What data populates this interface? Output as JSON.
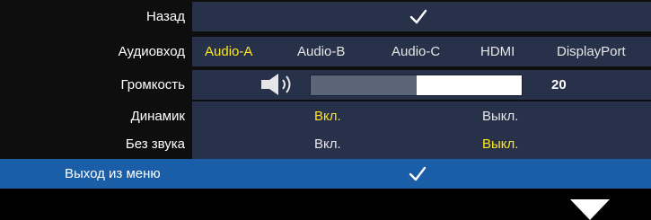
{
  "menu": {
    "back": {
      "label": "Назад"
    },
    "audio_input": {
      "label": "Аудиовход",
      "options": [
        "Audio-A",
        "Audio-B",
        "Audio-C",
        "HDMI",
        "DisplayPort"
      ],
      "selected": "Audio-A"
    },
    "volume": {
      "label": "Громкость",
      "value": "20",
      "level_fraction": 0.5
    },
    "speaker": {
      "label": "Динамик",
      "on": "Вкл.",
      "off": "Выкл.",
      "selected": "Вкл."
    },
    "mute": {
      "label": "Без звука",
      "on": "Вкл.",
      "off": "Выкл.",
      "selected": "Выкл."
    },
    "exit": {
      "label": "Выход из меню"
    }
  },
  "colors": {
    "selected_text": "#ffe51e",
    "highlight_row": "#1a5ea8",
    "value_area": "#27314a"
  },
  "icons": {
    "confirm": "checkmark-icon",
    "volume": "speaker-icon",
    "more": "down-triangle-icon"
  }
}
